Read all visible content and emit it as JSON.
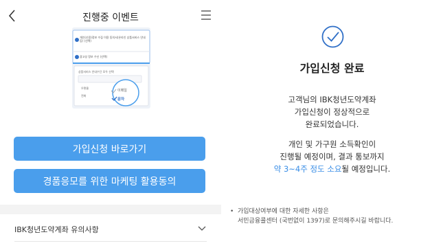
{
  "left": {
    "header": {
      "title": "진행중 이벤트"
    },
    "illustration": {
      "line1": "개인(신용)정보 수집 이용 동의서(온라인 상품서비스 안내 등) (선택)",
      "line2": "광고성 정보 수신 (선택)",
      "line3": "상품서비스 안내수단 모두 선택",
      "option_email": "이메일",
      "option_sms": "문자",
      "option_phone": "우편물",
      "option_call": "전화"
    },
    "join_button": "가입신청 바로가기",
    "marketing_button": "경품응모를 위한 마케팅 활용동의",
    "notice": {
      "label": "IBK청년도약계좌 유의사항"
    }
  },
  "right": {
    "title": "가입신청 완료",
    "message1": [
      "고객님의 IBK청년도약계좌",
      "가입신청이 정상적으로",
      "완료되었습니다."
    ],
    "message2_line1": "개인 및 가구원 소득확인이",
    "message2_line2": "진행될 예정이며, 결과 통보까지",
    "message2_highlight": "약 3~4주 정도 소요",
    "message2_rest": "될 예정입니다.",
    "footnote": [
      "가입대상여부에 대한 자세한 사항은",
      "서민금융콜센터 (국번없이 1397)로 문의해주시길 바랍니다."
    ]
  },
  "colors": {
    "accent": "#4a9eec",
    "highlight": "#3a8ee6",
    "icon_blue": "#2f6fc7"
  },
  "icons": [
    "back-arrow",
    "hamburger-menu",
    "chevron-down",
    "check-circle"
  ]
}
